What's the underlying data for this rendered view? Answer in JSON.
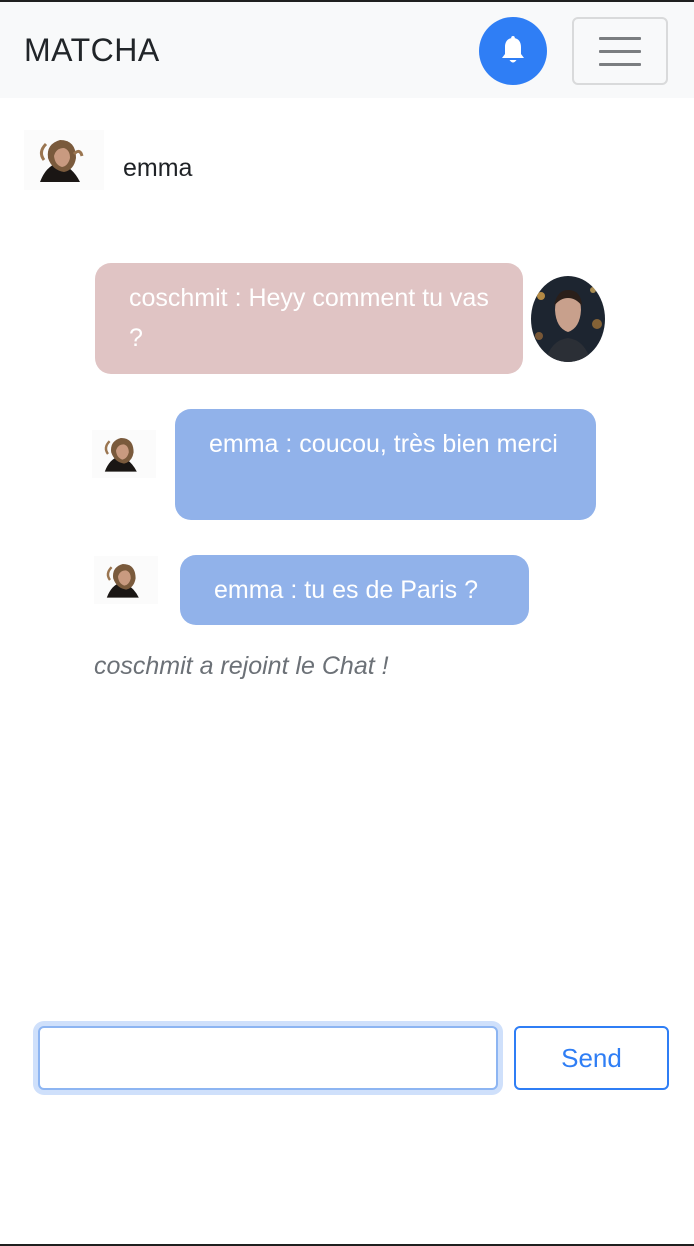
{
  "navbar": {
    "brand": "MATCHA",
    "notification_icon": "bell-icon",
    "menu_icon": "hamburger-icon"
  },
  "chat_header": {
    "user_name": "emma"
  },
  "messages": [
    {
      "sender": "coschmit",
      "text": "coschmit : Heyy comment tu vas ?",
      "side": "right"
    },
    {
      "sender": "emma",
      "text": "emma : coucou, très bien merci",
      "side": "left"
    },
    {
      "sender": "emma",
      "text": "emma : tu es de Paris ?",
      "side": "left"
    }
  ],
  "system_message": "coschmit a rejoint le Chat !",
  "composer": {
    "input_value": "",
    "send_label": "Send"
  },
  "colors": {
    "accent": "#2f7ef5",
    "own_bubble": "#e0c4c4",
    "other_bubble": "#91b2ea",
    "navbar_bg": "#f8f9fa"
  }
}
